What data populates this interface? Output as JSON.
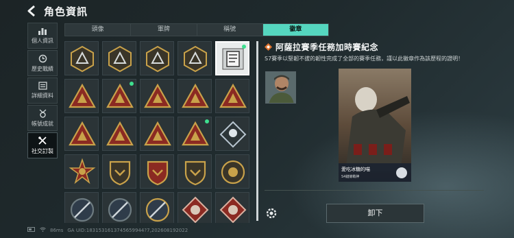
{
  "header": {
    "title": "角色資訊"
  },
  "sidebar": {
    "items": [
      {
        "label": "個人資訊",
        "icon": "bar-chart-icon"
      },
      {
        "label": "歷史戰績",
        "icon": "clock-icon"
      },
      {
        "label": "詳細資料",
        "icon": "list-icon"
      },
      {
        "label": "帳號成就",
        "icon": "medal-icon"
      },
      {
        "label": "社交訂製",
        "icon": "tools-icon",
        "active": true
      }
    ]
  },
  "tabs": [
    "頭像",
    "軍牌",
    "稱號",
    "徽章"
  ],
  "active_tab": "徽章",
  "detail": {
    "title": "阿薩拉賽季任務加時賽紀念",
    "description": "S7賽季以堅韌不拔的韌性完成了全部的賽季任務，謹以此徽章作為該歷程的證明！",
    "card_name": "愛吃冰糖的喵",
    "card_sub": "S4鏈條戰神",
    "unequip_label": "卸下"
  },
  "status": {
    "ping": "86ms",
    "uid": "GA UID:1831531613745659944?7,202608192022"
  },
  "colors": {
    "accent": "#55d6bf",
    "new_dot": "#3ee08f",
    "badge_gold": "#c9a24a",
    "badge_red": "#8b2a22"
  },
  "badges": [
    {
      "icon": "hex-triangle-badge-icon"
    },
    {
      "icon": "helicopter-badge-icon"
    },
    {
      "icon": "hex-compass-badge-icon"
    },
    {
      "icon": "shield-arrow-badge-icon"
    },
    {
      "icon": "document-badge-icon",
      "selected": true,
      "new": true
    },
    {
      "icon": "triangle-sign-badge-icon"
    },
    {
      "icon": "triangle-plane-badge-icon",
      "new": true
    },
    {
      "icon": "triangle-tank-badge-icon"
    },
    {
      "icon": "triangle-number-badge-icon"
    },
    {
      "icon": "triangle-tower-badge-icon"
    },
    {
      "icon": "triangle-soldier-badge-icon"
    },
    {
      "icon": "triangle-figure-badge-icon"
    },
    {
      "icon": "triangle-horse-badge-icon"
    },
    {
      "icon": "triangle-rocket-badge-icon",
      "new": true
    },
    {
      "icon": "diamond-emblem-badge-icon"
    },
    {
      "icon": "star-wreath-badge-icon"
    },
    {
      "icon": "shield-chevron-badge-icon"
    },
    {
      "icon": "shield-stars-badge-icon"
    },
    {
      "icon": "shield-eagle-badge-icon"
    },
    {
      "icon": "round-laurel-badge-icon"
    },
    {
      "icon": "round-crosshair-badge-icon"
    },
    {
      "icon": "shield-plane-badge-icon"
    },
    {
      "icon": "round-rifle-badge-icon"
    },
    {
      "icon": "diamond-beast-badge-icon"
    },
    {
      "icon": "diamond-wolf-badge-icon"
    }
  ]
}
